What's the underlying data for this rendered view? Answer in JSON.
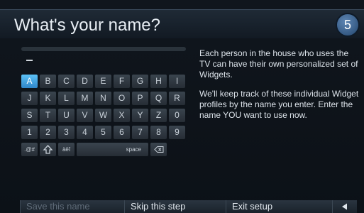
{
  "header": {
    "title": "What's your name?",
    "step": "5"
  },
  "keyboard": {
    "rows": [
      [
        "A",
        "B",
        "C",
        "D",
        "E",
        "F",
        "G",
        "H",
        "I"
      ],
      [
        "J",
        "K",
        "L",
        "M",
        "N",
        "O",
        "P",
        "Q",
        "R"
      ],
      [
        "S",
        "T",
        "U",
        "V",
        "W",
        "X",
        "Y",
        "Z",
        "0"
      ],
      [
        "1",
        "2",
        "3",
        "4",
        "5",
        "6",
        "7",
        "8",
        "9"
      ]
    ],
    "symbols_label": ".@#",
    "accent_label": "àëî",
    "space_label": "space",
    "selected_key": "A"
  },
  "description": {
    "paragraph1": "Each person in the house who uses the TV can have their own personalized set of Widgets.",
    "paragraph2": "We'll keep track of these individual Widget profiles by the name you enter. Enter the name YOU want to use now."
  },
  "footer": {
    "save_label": "Save this name",
    "skip_label": "Skip this step",
    "exit_label": "Exit setup",
    "back_icon": "back-arrow-icon"
  },
  "colors": {
    "accent": "#3fa3e0",
    "background": "#0c1117"
  }
}
